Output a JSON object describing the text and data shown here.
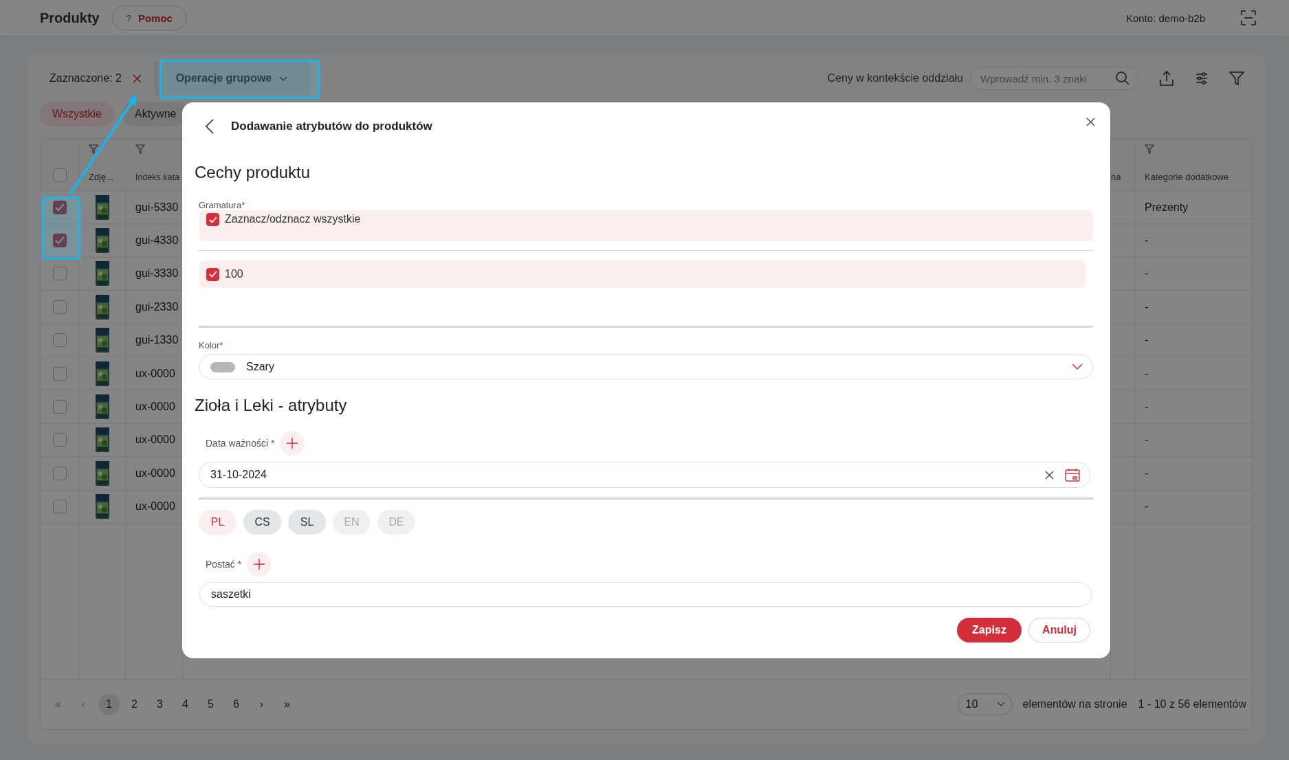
{
  "topbar": {
    "title": "Produkty",
    "help": {
      "glyph": "?",
      "label": "Pomoc"
    },
    "account": "Konto: demo-b2b"
  },
  "toolbar": {
    "selected_count": "Zaznaczone: 2",
    "bulk_button": "Operacje grupowe",
    "price_context": "Ceny w kontekście oddziału",
    "search": {
      "placeholder": "Wprowadź min. 3 znaki"
    }
  },
  "filter_tabs": [
    {
      "label": "Wszystkie",
      "selected": true
    },
    {
      "label": "Aktywne",
      "selected": false
    }
  ],
  "table": {
    "select_all_checked": false,
    "columns": [
      {
        "label": "Zdję...",
        "filter": true
      },
      {
        "label": "Indeks kata",
        "filter": true
      },
      {
        "label": "na",
        "filter": false
      },
      {
        "label": "Kategorie dodatkowe",
        "filter": true
      }
    ],
    "rows": [
      {
        "checked": true,
        "index": "gui-5330",
        "category": "Prezenty"
      },
      {
        "checked": true,
        "index": "gui-4330",
        "category": "-"
      },
      {
        "checked": false,
        "index": "gui-3330",
        "category": "-"
      },
      {
        "checked": false,
        "index": "gui-2330",
        "category": "-"
      },
      {
        "checked": false,
        "index": "gui-1330",
        "category": "-"
      },
      {
        "checked": false,
        "index": "ux-0000",
        "category": "-"
      },
      {
        "checked": false,
        "index": "ux-0000",
        "category": "-"
      },
      {
        "checked": false,
        "index": "ux-0000",
        "category": "-"
      },
      {
        "checked": false,
        "index": "ux-0000",
        "category": "-"
      },
      {
        "checked": false,
        "index": "ux-0000",
        "category": "-"
      }
    ]
  },
  "pagination": {
    "first": "«",
    "prev": "‹",
    "pages": [
      {
        "label": "1",
        "selected": true
      },
      {
        "label": "2",
        "selected": false
      },
      {
        "label": "3",
        "selected": false
      },
      {
        "label": "4",
        "selected": false
      },
      {
        "label": "5",
        "selected": false
      },
      {
        "label": "6",
        "selected": false
      }
    ],
    "next": "›",
    "last": "»",
    "page_size": "10",
    "per_page_label": "elementów na stronie",
    "range": "1 - 10 z 56 elementów"
  },
  "modal": {
    "title": "Dodawanie atrybutów do produktów",
    "section_1": "Cechy produktu",
    "gramatura": {
      "label": "Gramatura",
      "required_mark": "*",
      "select_all": {
        "label": "Zaznacz/odznacz wszystkie",
        "checked": true
      },
      "options": [
        {
          "label": "100",
          "checked": true
        }
      ]
    },
    "kolor": {
      "label": "Kolor",
      "required_mark": "*",
      "value": "Szary"
    },
    "section_2": "Zioła i Leki - atrybuty",
    "expiry": {
      "label": "Data ważności",
      "required_mark": "*",
      "value": "31-10-2024"
    },
    "languages": [
      {
        "label": "PL",
        "selected": true,
        "disabled": false
      },
      {
        "label": "CS",
        "selected": false,
        "disabled": false
      },
      {
        "label": "SL",
        "selected": false,
        "disabled": false
      },
      {
        "label": "EN",
        "selected": false,
        "disabled": true
      },
      {
        "label": "DE",
        "selected": false,
        "disabled": true
      }
    ],
    "form": {
      "label": "Postać",
      "required_mark": "*",
      "value": "saszetki"
    },
    "buttons": {
      "save": "Zapisz",
      "cancel": "Anuluj"
    }
  }
}
